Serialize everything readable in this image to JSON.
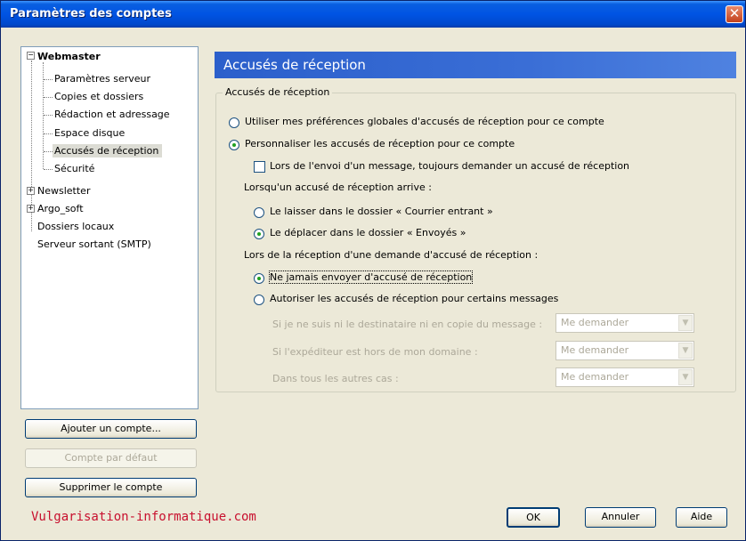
{
  "window": {
    "title": "Paramètres des comptes",
    "close_glyph": "✕"
  },
  "tree": {
    "expander_minus": "−",
    "expander_plus": "+",
    "webmaster": {
      "label": "Webmaster",
      "children": [
        "Paramètres serveur",
        "Copies et dossiers",
        "Rédaction et adressage",
        "Espace disque",
        "Accusés de réception",
        "Sécurité"
      ],
      "selected": "Accusés de réception"
    },
    "newsletter": "Newsletter",
    "argo": "Argo_soft",
    "local": "Dossiers locaux",
    "smtp": "Serveur sortant (SMTP)"
  },
  "buttons": {
    "add_account": "Ajouter un compte...",
    "default_account": "Compte par défaut",
    "delete_account": "Supprimer le compte",
    "ok": "OK",
    "cancel": "Annuler",
    "help": "Aide"
  },
  "panel": {
    "title": "Accusés de réception",
    "group_label": "Accusés de réception",
    "use_global": "Utiliser mes préférences globales d'accusés de réception pour ce compte",
    "customize": "Personnaliser les accusés de réception pour ce compte",
    "always_request": "Lors de l'envoi d'un message, toujours demander un accusé de réception",
    "when_arrives": "Lorsqu'un accusé de réception arrive :",
    "leave_inbox": "Le laisser dans le dossier « Courrier entrant »",
    "move_sent": "Le déplacer dans le dossier « Envoyés »",
    "when_request": "Lors de la réception d'une demande d'accusé de réception :",
    "never_send": "Ne jamais envoyer d'accusé de réception",
    "allow_some": "Autoriser les accusés de réception pour certains messages",
    "not_recipient_label": "Si je ne suis ni le destinataire ni en copie du message :",
    "outside_domain_label": "Si l'expéditeur est hors de mon domaine :",
    "other_cases_label": "Dans tous les autres cas :",
    "not_recipient_value": "Me demander",
    "outside_domain_value": "Me demander",
    "other_cases_value": "Me demander",
    "dropdown_arrow": "▼"
  },
  "watermark": "Vulgarisation-informatique.com",
  "colors": {
    "title_bar": "#0054e3",
    "header": "#3a6ed6",
    "radio_dot": "#21a121",
    "watermark": "#c8102e"
  },
  "state": {
    "receipts_mode": "customize",
    "always_request": false,
    "on_arrival": "move_sent",
    "on_request": "never_send"
  }
}
